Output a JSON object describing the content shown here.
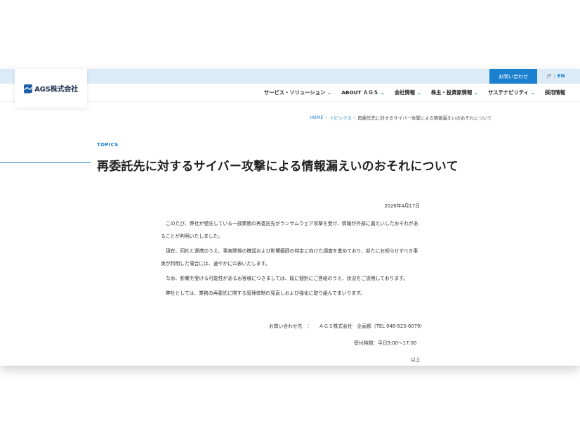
{
  "header": {
    "logo_text": "AGS株式会社",
    "logo_sub": "AGS",
    "contact_button": "お問い合わせ",
    "lang_jp": "JP",
    "lang_sep": "|",
    "lang_en": "EN",
    "nav": [
      {
        "label": "サービス・ソリューション",
        "chevron": true
      },
      {
        "label": "ABOUT ＡＧＳ",
        "chevron": true
      },
      {
        "label": "会社情報",
        "chevron": true
      },
      {
        "label": "株主・投資家情報",
        "chevron": true
      },
      {
        "label": "サステナビリティ",
        "chevron": true
      },
      {
        "label": "採用情報",
        "chevron": false
      }
    ]
  },
  "breadcrumb": {
    "home": "HOME",
    "topics": "トピックス",
    "current": "再委託先に対するサイバー攻撃による情報漏えいのおそれについて",
    "separator": "›"
  },
  "article": {
    "section": "TOPICS",
    "title": "再委託先に対するサイバー攻撃による情報漏えいのおそれについて",
    "date": "2026年4月17日",
    "paragraphs": [
      "このたび、弊社が受託している一部業務の再委託先がランサムウェア攻撃を受け、情報が外部に漏えいしたおそれがあることが判明いたしました。",
      "現在、同社と連携のうえ、事実関係の確認および影響範囲の特定に向けた調査を進めており、新たにお知らせすべき事実が判明した場合には、速やかに公表いたします。",
      "なお、影響を受ける可能性があるお客様につきましては、既に個別にご連絡のうえ、状況をご説明しております。",
      "弊社としては、業務の再委託に関する管理体制の見直しおよび強化に取り組んでまいります。"
    ],
    "contact_label": "お問い合わせ先　：",
    "contact_value": "ＡＧＳ株式会社　企画部（TEL 048-825-6079）",
    "hours": "受付時間：平日9:00～17:00",
    "closing": "以上"
  },
  "colors": {
    "accent": "#1b80cf",
    "band": "#dcebf8"
  }
}
